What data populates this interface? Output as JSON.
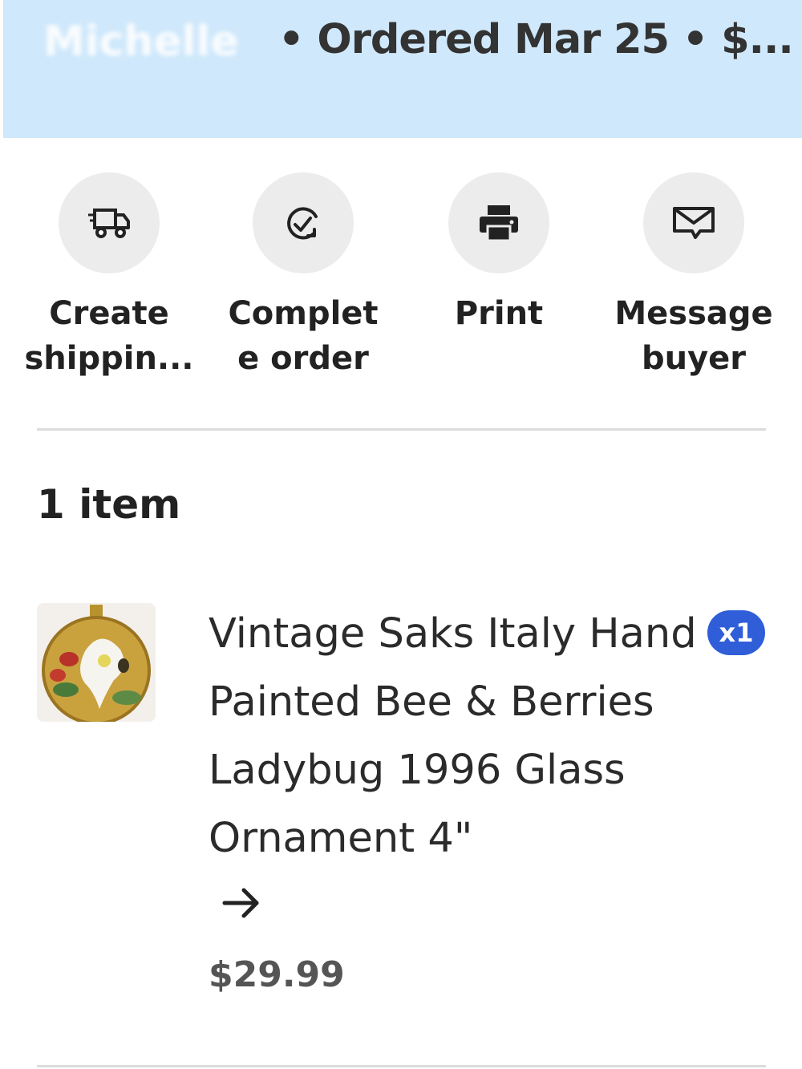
{
  "header": {
    "buyer_name_redacted": "Michelle",
    "title": "• Ordered Mar 25 • $..."
  },
  "actions": [
    {
      "label": "Create shippin...",
      "icon": "shipping-truck-icon"
    },
    {
      "label": "Complet e order",
      "icon": "complete-order-icon"
    },
    {
      "label": "Print",
      "icon": "printer-icon"
    },
    {
      "label": "Message buyer",
      "icon": "message-envelope-icon"
    }
  ],
  "items_section": {
    "heading": "1 item"
  },
  "item": {
    "title": "Vintage Saks Italy Hand Painted Bee & Berries Ladybug 1996 Glass Ornament 4\"",
    "price": "$29.99",
    "quantity": "x1",
    "thumbnail_icon": "ornament-thumbnail",
    "link_icon": "arrow-right-icon"
  },
  "colors": {
    "header_bg": "#cfe8fb",
    "badge_bg": "#2f5ed8",
    "action_circle_bg": "#ececec"
  }
}
